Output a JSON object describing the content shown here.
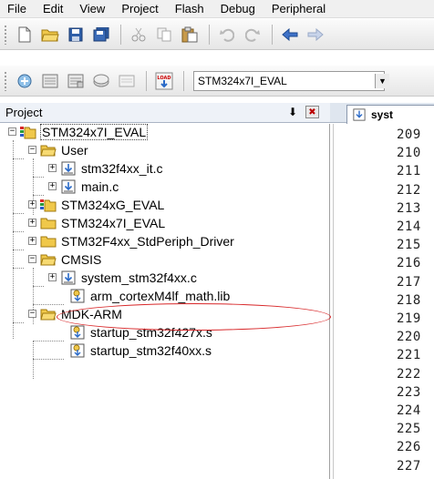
{
  "menubar": {
    "items": [
      {
        "label": "File"
      },
      {
        "label": "Edit"
      },
      {
        "label": "View"
      },
      {
        "label": "Project"
      },
      {
        "label": "Flash"
      },
      {
        "label": "Debug"
      },
      {
        "label": "Peripheral"
      }
    ]
  },
  "toolbar1": {
    "icons": [
      "new-file-icon",
      "open-folder-icon",
      "save-icon",
      "save-all-icon",
      "cut-icon",
      "copy-icon",
      "paste-icon",
      "undo-icon",
      "redo-icon",
      "back-arrow-icon",
      "forward-arrow-icon"
    ]
  },
  "toolbar2": {
    "icons": [
      "translate-icon",
      "build-icon",
      "rebuild-icon",
      "batch-build-icon",
      "stop-build-icon",
      "download-load-icon"
    ],
    "download_badge": "LOAD",
    "target_select": {
      "value": "STM324x7I_EVAL"
    }
  },
  "project_panel": {
    "title": "Project",
    "pin_glyph": "⬇",
    "close_glyph": "✖"
  },
  "tree": {
    "root": "STM324x7I_EVAL",
    "nodes": [
      {
        "label": "User"
      },
      {
        "label": "stm32f4xx_it.c"
      },
      {
        "label": "main.c"
      },
      {
        "label": "STM324xG_EVAL"
      },
      {
        "label": "STM324x7I_EVAL"
      },
      {
        "label": "STM32F4xx_StdPeriph_Driver"
      },
      {
        "label": "CMSIS"
      },
      {
        "label": "system_stm32f4xx.c"
      },
      {
        "label": "arm_cortexM4lf_math.lib"
      },
      {
        "label": "MDK-ARM"
      },
      {
        "label": "startup_stm32f427x.s"
      },
      {
        "label": "startup_stm32f40xx.s"
      }
    ]
  },
  "editor": {
    "tab_label": "syst",
    "line_numbers": [
      "209",
      "210",
      "211",
      "212",
      "213",
      "214",
      "215",
      "216",
      "217",
      "218",
      "219",
      "220",
      "221",
      "222",
      "223",
      "224",
      "225",
      "226",
      "227"
    ]
  },
  "colors": {
    "folder": "#f0c84a",
    "callout": "#d8282a",
    "panel_header": "#eef2f8"
  }
}
